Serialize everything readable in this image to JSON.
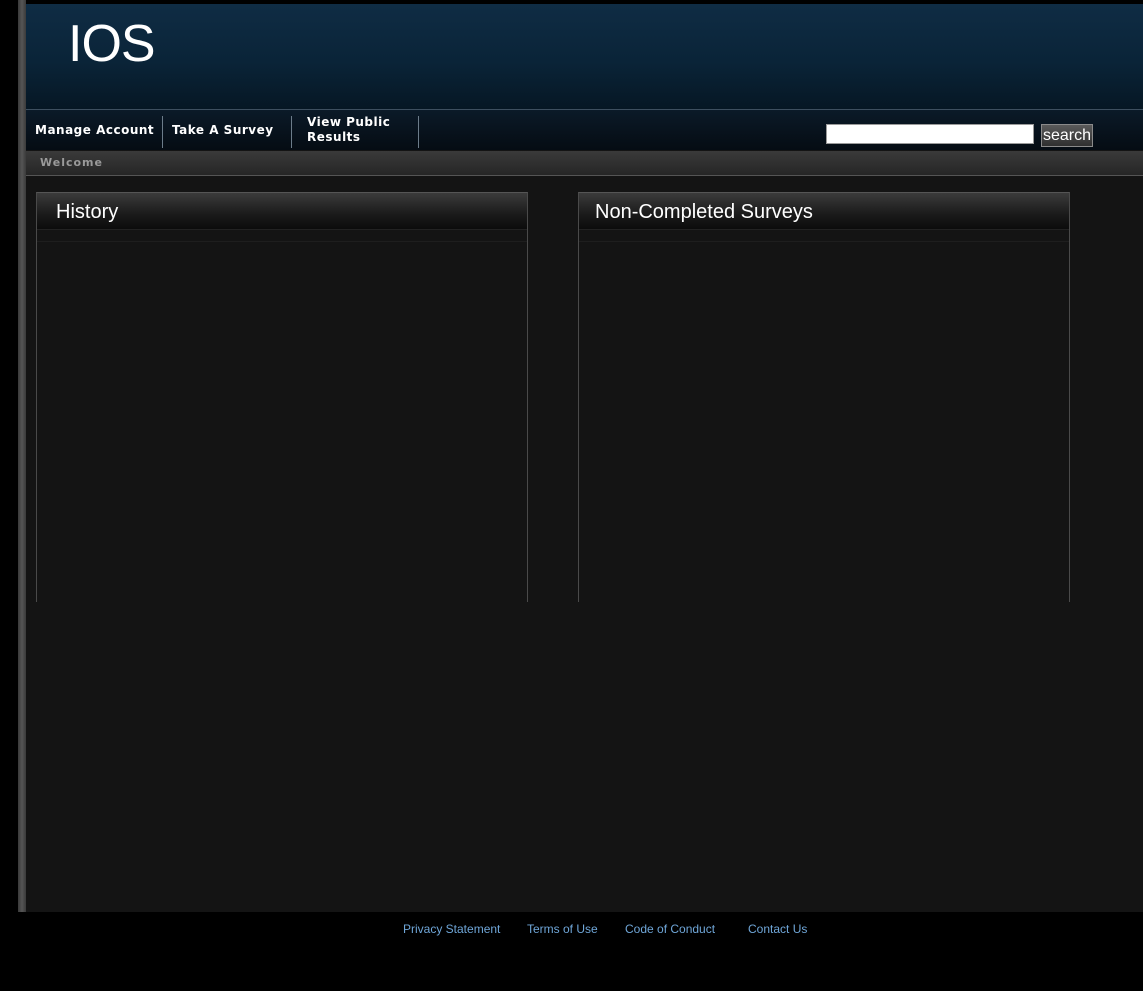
{
  "header": {
    "brand": "IOS"
  },
  "nav": {
    "items": [
      {
        "label": "Manage Account"
      },
      {
        "label": "Take A Survey"
      },
      {
        "label": "View Public Results"
      }
    ],
    "search": {
      "value": "",
      "button_label": "search"
    }
  },
  "breadcrumb": {
    "label": "Welcome"
  },
  "panels": {
    "history": {
      "title": "History"
    },
    "noncompleted": {
      "title": "Non-Completed Surveys"
    }
  },
  "footer": {
    "links": [
      {
        "label": "Privacy Statement"
      },
      {
        "label": "Terms of Use"
      },
      {
        "label": "Code of Conduct"
      },
      {
        "label": "Contact Us"
      }
    ]
  },
  "colors": {
    "header_bg": "#0a2438",
    "page_bg": "#141414",
    "footer_link": "#6fa6d8"
  }
}
